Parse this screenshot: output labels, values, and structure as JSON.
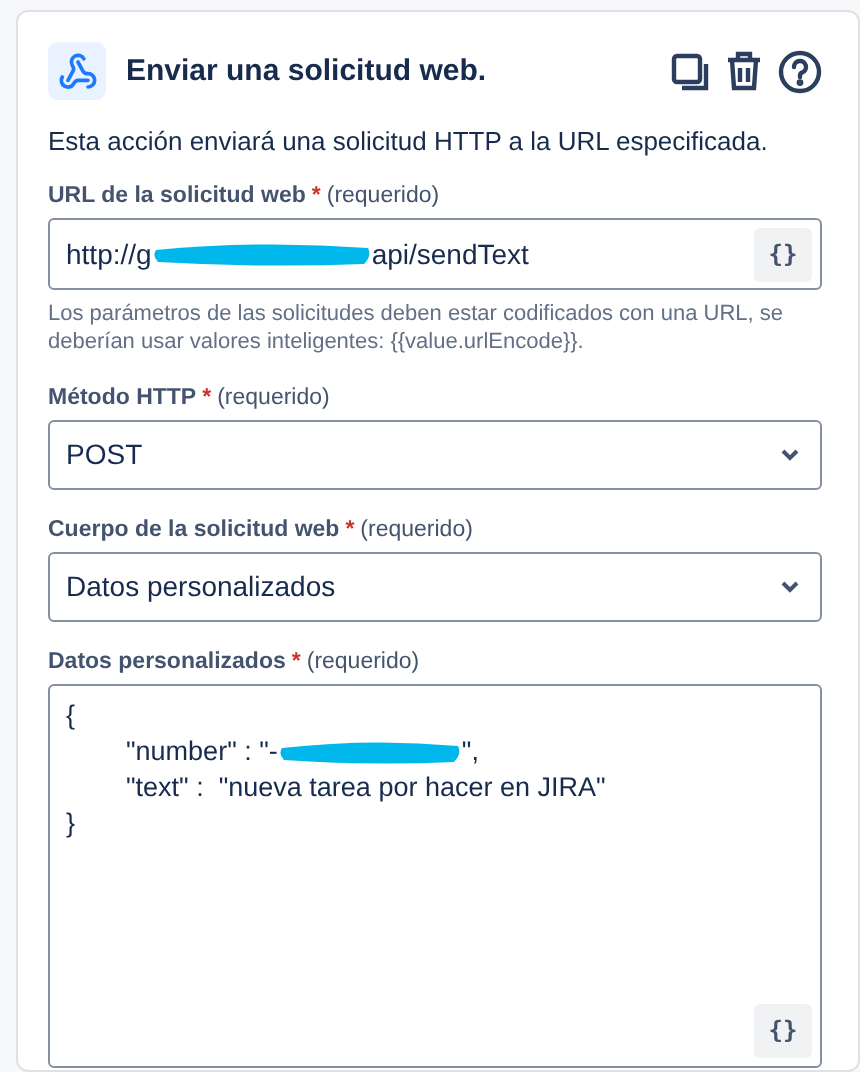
{
  "header": {
    "title": "Enviar una solicitud web."
  },
  "description": "Esta acción enviará una solicitud HTTP a la URL especificada.",
  "fields": [
    {
      "kind": "text",
      "label": "URL de la solicitud web",
      "required_mark": "*",
      "required_text": "(requerido)",
      "value_before": "http://g",
      "redacted": true,
      "value_after": "api/sendText",
      "smart_button": "{}",
      "help": "Los parámetros de las solicitudes deben estar codificados con una URL, se deberían usar valores inteligentes: {{value.urlEncode}}."
    },
    {
      "kind": "select",
      "label": "Método HTTP",
      "required_mark": "*",
      "required_text": "(requerido)",
      "value": "POST"
    },
    {
      "kind": "select",
      "label": "Cuerpo de la solicitud web",
      "required_mark": "*",
      "required_text": "(requerido)",
      "value": "Datos personalizados"
    },
    {
      "kind": "code",
      "label": "Datos personalizados",
      "required_mark": "*",
      "required_text": "(requerido)",
      "smart_button": "{}",
      "lines": [
        {
          "indent": false,
          "before": "{",
          "redacted": false
        },
        {
          "indent": true,
          "before": "\"number\" : \"-",
          "redacted": true,
          "after": "\","
        },
        {
          "indent": true,
          "before": "\"text\" :  \"nueva tarea por hacer en JIRA\"",
          "redacted": false
        },
        {
          "indent": false,
          "before": "}",
          "redacted": false
        }
      ]
    }
  ]
}
